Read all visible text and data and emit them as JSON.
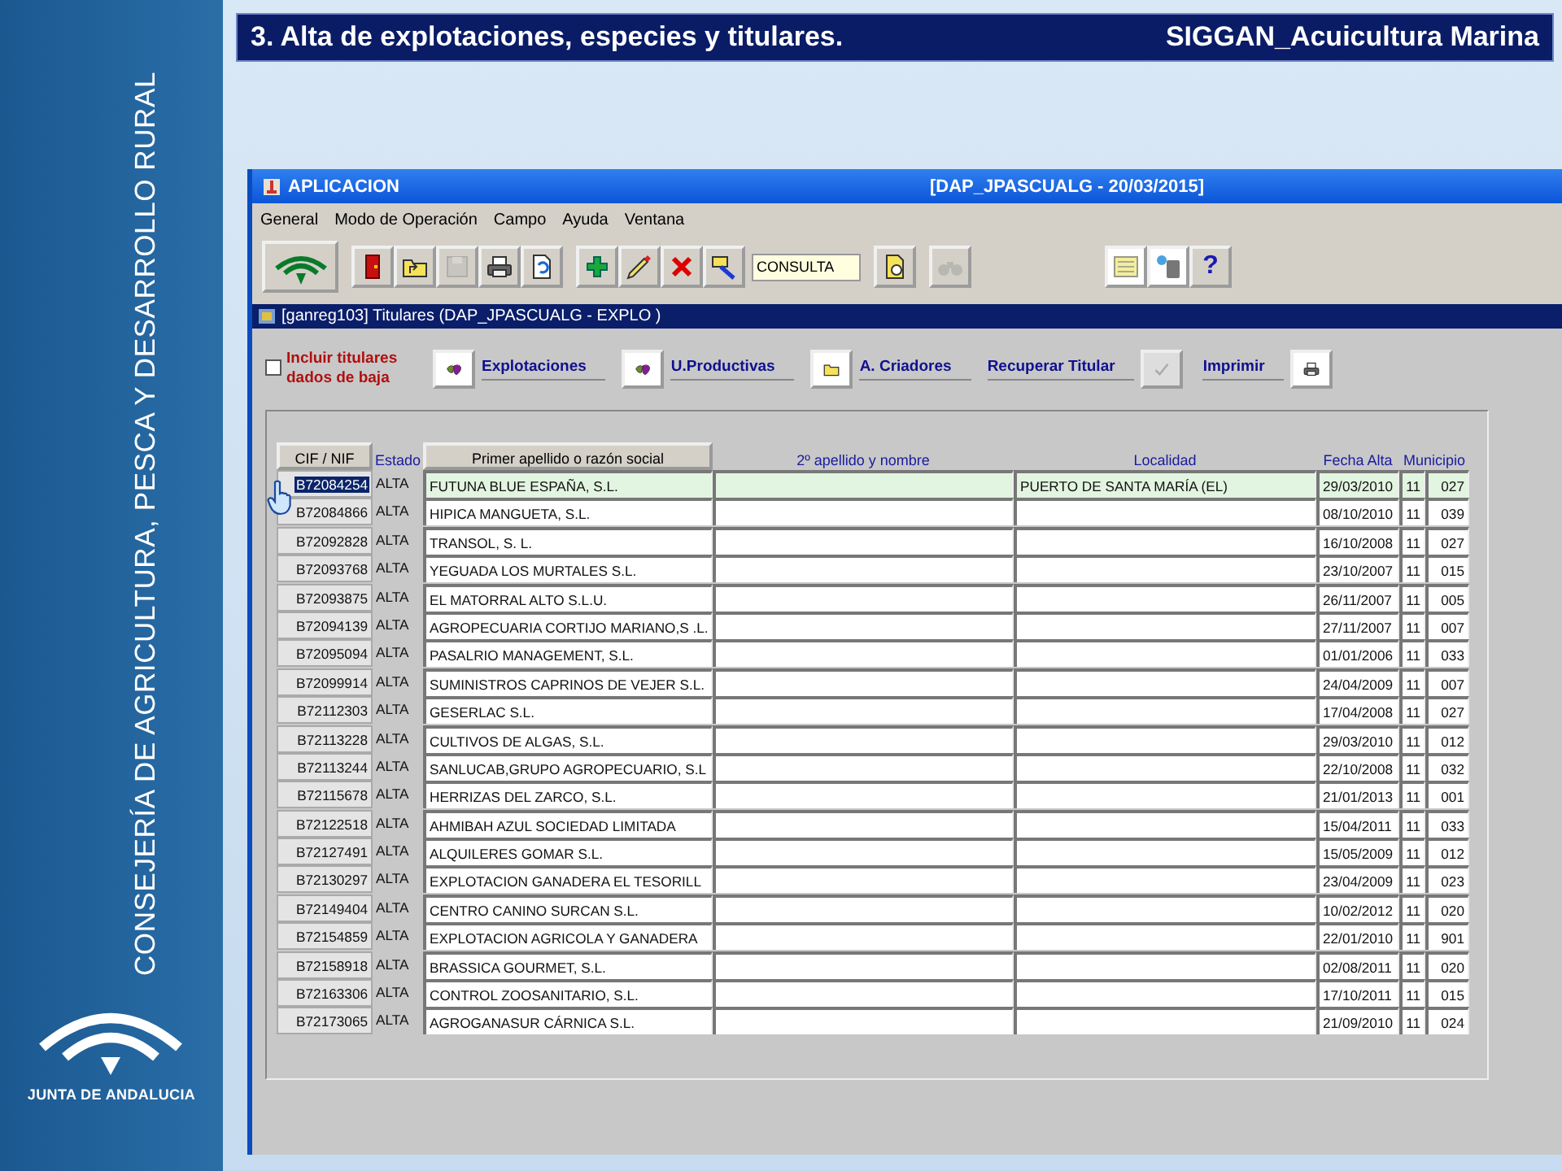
{
  "sidebar": {
    "organization": "CONSEJERÍA DE AGRICULTURA, PESCA Y DESARROLLO RURAL",
    "logo_text": "JUNTA DE ANDALUCIA"
  },
  "slide_header": {
    "title": "3. Alta de explotaciones, especies y titulares.",
    "subtitle": "SIGGAN_Acuicultura Marina"
  },
  "window": {
    "title": "APLICACION",
    "session": "[DAP_JPASCUALG - 20/03/2015]"
  },
  "menu": [
    "General",
    "Modo de Operación",
    "Campo",
    "Ayuda",
    "Ventana"
  ],
  "toolbar": [
    [
      {
        "kind": "logo",
        "disabled": false
      }
    ],
    [
      {
        "kind": "exit",
        "disabled": false
      },
      {
        "kind": "folder-up",
        "disabled": false
      },
      {
        "kind": "save",
        "disabled": true
      },
      {
        "kind": "print",
        "disabled": false
      },
      {
        "kind": "refresh",
        "disabled": false
      }
    ],
    [
      {
        "kind": "add",
        "disabled": false
      },
      {
        "kind": "edit",
        "disabled": false
      },
      {
        "kind": "delete",
        "disabled": false
      },
      {
        "kind": "query",
        "disabled": false
      }
    ],
    [
      {
        "kind": "mode-field",
        "value": "CONSULTA"
      }
    ],
    [
      {
        "kind": "find-doc",
        "disabled": false
      }
    ],
    [
      {
        "kind": "binoculars",
        "disabled": true
      }
    ],
    [
      {
        "kind": "notes",
        "disabled": false
      },
      {
        "kind": "id-card",
        "disabled": false
      },
      {
        "kind": "help",
        "label": "?",
        "disabled": false
      }
    ]
  ],
  "form": {
    "title": "[ganreg103] Titulares (DAP_JPASCUALG - EXPLO )",
    "include_checkbox": {
      "label": "Incluir titulares dados de baja",
      "checked": false
    },
    "actions": [
      {
        "kind": "map",
        "label": "Explotaciones",
        "disabled": false
      },
      {
        "kind": "map",
        "label": "U.Productivas",
        "disabled": false
      },
      {
        "kind": "folder",
        "label": "A. Criadores",
        "disabled": false
      },
      {
        "kind": "check",
        "label": "Recuperar Titular",
        "disabled": true
      },
      {
        "kind": "print",
        "label": "Imprimir",
        "disabled": false
      }
    ]
  },
  "table": {
    "columns": [
      {
        "label": "CIF / NIF",
        "kind": "button"
      },
      {
        "label": "Estado",
        "kind": "plain"
      },
      {
        "label": "Primer apellido o razón social",
        "kind": "button"
      },
      {
        "label": "2º apellido y nombre",
        "kind": "plain"
      },
      {
        "label": "Localidad",
        "kind": "plain"
      },
      {
        "label": "Fecha Alta",
        "kind": "plain"
      },
      {
        "label": "Municipio",
        "kind": "plain"
      }
    ],
    "rows": [
      {
        "cif": "B72084254",
        "estado": "ALTA",
        "razon_social": "FUTUNA BLUE ESPAÑA, S.L.",
        "localidad": "PUERTO DE SANTA MARÍA (EL)",
        "fecha_alta": "29/03/2010",
        "provincia": "11",
        "municipio": "027",
        "selected": true
      },
      {
        "cif": "B72084866",
        "estado": "ALTA",
        "razon_social": "HIPICA MANGUETA, S.L.",
        "fecha_alta": "08/10/2010",
        "provincia": "11",
        "municipio": "039",
        "selected": false
      },
      {
        "cif": "B72092828",
        "estado": "ALTA",
        "razon_social": "TRANSOL, S. L.",
        "fecha_alta": "16/10/2008",
        "provincia": "11",
        "municipio": "027",
        "selected": false
      },
      {
        "cif": "B72093768",
        "estado": "ALTA",
        "razon_social": "YEGUADA LOS MURTALES S.L.",
        "fecha_alta": "23/10/2007",
        "provincia": "11",
        "municipio": "015",
        "selected": false
      },
      {
        "cif": "B72093875",
        "estado": "ALTA",
        "razon_social": "EL MATORRAL ALTO S.L.U.",
        "fecha_alta": "26/11/2007",
        "provincia": "11",
        "municipio": "005",
        "selected": false
      },
      {
        "cif": "B72094139",
        "estado": "ALTA",
        "razon_social": "AGROPECUARIA CORTIJO MARIANO,S .L.",
        "fecha_alta": "27/11/2007",
        "provincia": "11",
        "municipio": "007",
        "selected": false
      },
      {
        "cif": "B72095094",
        "estado": "ALTA",
        "razon_social": "PASALRIO MANAGEMENT, S.L.",
        "fecha_alta": "01/01/2006",
        "provincia": "11",
        "municipio": "033",
        "selected": false
      },
      {
        "cif": "B72099914",
        "estado": "ALTA",
        "razon_social": "SUMINISTROS CAPRINOS DE VEJER S.L.",
        "fecha_alta": "24/04/2009",
        "provincia": "11",
        "municipio": "007",
        "selected": false
      },
      {
        "cif": "B72112303",
        "estado": "ALTA",
        "razon_social": "GESERLAC S.L.",
        "fecha_alta": "17/04/2008",
        "provincia": "11",
        "municipio": "027",
        "selected": false
      },
      {
        "cif": "B72113228",
        "estado": "ALTA",
        "razon_social": "CULTIVOS DE ALGAS, S.L.",
        "fecha_alta": "29/03/2010",
        "provincia": "11",
        "municipio": "012",
        "selected": false
      },
      {
        "cif": "B72113244",
        "estado": "ALTA",
        "razon_social": "SANLUCAB,GRUPO AGROPECUARIO, S.L",
        "fecha_alta": "22/10/2008",
        "provincia": "11",
        "municipio": "032",
        "selected": false
      },
      {
        "cif": "B72115678",
        "estado": "ALTA",
        "razon_social": "HERRIZAS DEL ZARCO, S.L.",
        "fecha_alta": "21/01/2013",
        "provincia": "11",
        "municipio": "001",
        "selected": false
      },
      {
        "cif": "B72122518",
        "estado": "ALTA",
        "razon_social": "AHMIBAH AZUL SOCIEDAD LIMITADA",
        "fecha_alta": "15/04/2011",
        "provincia": "11",
        "municipio": "033",
        "selected": false
      },
      {
        "cif": "B72127491",
        "estado": "ALTA",
        "razon_social": "ALQUILERES GOMAR S.L.",
        "fecha_alta": "15/05/2009",
        "provincia": "11",
        "municipio": "012",
        "selected": false
      },
      {
        "cif": "B72130297",
        "estado": "ALTA",
        "razon_social": "EXPLOTACION GANADERA EL TESORILL",
        "fecha_alta": "23/04/2009",
        "provincia": "11",
        "municipio": "023",
        "selected": false
      },
      {
        "cif": "B72149404",
        "estado": "ALTA",
        "razon_social": "CENTRO CANINO SURCAN S.L.",
        "fecha_alta": "10/02/2012",
        "provincia": "11",
        "municipio": "020",
        "selected": false
      },
      {
        "cif": "B72154859",
        "estado": "ALTA",
        "razon_social": "EXPLOTACION AGRICOLA Y GANADERA",
        "fecha_alta": "22/01/2010",
        "provincia": "11",
        "municipio": "901",
        "selected": false
      },
      {
        "cif": "B72158918",
        "estado": "ALTA",
        "razon_social": "BRASSICA GOURMET, S.L.",
        "fecha_alta": "02/08/2011",
        "provincia": "11",
        "municipio": "020",
        "selected": false
      },
      {
        "cif": "B72163306",
        "estado": "ALTA",
        "razon_social": "CONTROL ZOOSANITARIO, S.L.",
        "fecha_alta": "17/10/2011",
        "provincia": "11",
        "municipio": "015",
        "selected": false
      },
      {
        "cif": "B72173065",
        "estado": "ALTA",
        "razon_social": "AGROGANASUR CÁRNICA S.L.",
        "fecha_alta": "21/09/2010",
        "provincia": "11",
        "municipio": "024",
        "selected": false
      }
    ]
  }
}
